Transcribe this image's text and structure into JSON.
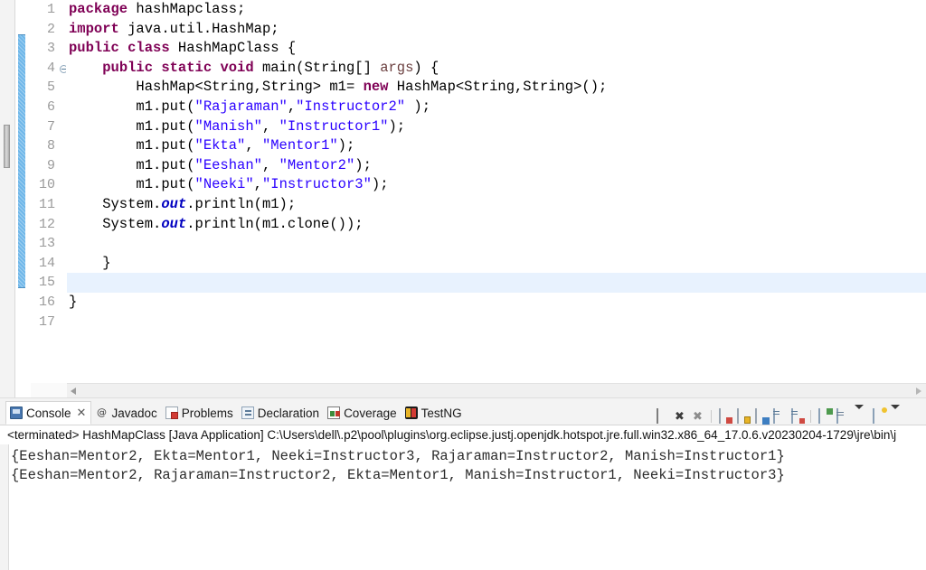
{
  "editor": {
    "name": "java-source-editor",
    "current_line": 15,
    "total_lines": 17,
    "line_numbers": [
      "1",
      "2",
      "3",
      "4",
      "5",
      "6",
      "7",
      "8",
      "9",
      "10",
      "11",
      "12",
      "13",
      "14",
      "15",
      "16",
      "17"
    ],
    "fold_marker_line": 4,
    "lines": [
      {
        "n": "1",
        "tokens": [
          {
            "t": "package",
            "c": "kw"
          },
          {
            "t": " hashMapclass;",
            "c": "plain"
          }
        ]
      },
      {
        "n": "2",
        "tokens": [
          {
            "t": "import",
            "c": "kw"
          },
          {
            "t": " java.util.HashMap;",
            "c": "plain"
          }
        ]
      },
      {
        "n": "3",
        "tokens": [
          {
            "t": "public class",
            "c": "kw"
          },
          {
            "t": " HashMapClass {",
            "c": "plain"
          }
        ]
      },
      {
        "n": "4",
        "tokens": [
          {
            "t": "    ",
            "c": "plain"
          },
          {
            "t": "public static void",
            "c": "kw"
          },
          {
            "t": " main(String[] ",
            "c": "plain"
          },
          {
            "t": "args",
            "c": "param"
          },
          {
            "t": ") {",
            "c": "plain"
          }
        ]
      },
      {
        "n": "5",
        "tokens": [
          {
            "t": "        HashMap<String,String> m1= ",
            "c": "plain"
          },
          {
            "t": "new",
            "c": "kw"
          },
          {
            "t": " HashMap<String,String>();",
            "c": "plain"
          }
        ]
      },
      {
        "n": "6",
        "tokens": [
          {
            "t": "        m1.put(",
            "c": "plain"
          },
          {
            "t": "\"Rajaraman\"",
            "c": "str"
          },
          {
            "t": ",",
            "c": "plain"
          },
          {
            "t": "\"Instructor2\"",
            "c": "str"
          },
          {
            "t": " );",
            "c": "plain"
          }
        ]
      },
      {
        "n": "7",
        "tokens": [
          {
            "t": "        m1.put(",
            "c": "plain"
          },
          {
            "t": "\"Manish\"",
            "c": "str"
          },
          {
            "t": ", ",
            "c": "plain"
          },
          {
            "t": "\"Instructor1\"",
            "c": "str"
          },
          {
            "t": ");",
            "c": "plain"
          }
        ]
      },
      {
        "n": "8",
        "tokens": [
          {
            "t": "        m1.put(",
            "c": "plain"
          },
          {
            "t": "\"Ekta\"",
            "c": "str"
          },
          {
            "t": ", ",
            "c": "plain"
          },
          {
            "t": "\"Mentor1\"",
            "c": "str"
          },
          {
            "t": ");",
            "c": "plain"
          }
        ]
      },
      {
        "n": "9",
        "tokens": [
          {
            "t": "        m1.put(",
            "c": "plain"
          },
          {
            "t": "\"Eeshan\"",
            "c": "str"
          },
          {
            "t": ", ",
            "c": "plain"
          },
          {
            "t": "\"Mentor2\"",
            "c": "str"
          },
          {
            "t": ");",
            "c": "plain"
          }
        ]
      },
      {
        "n": "10",
        "tokens": [
          {
            "t": "        m1.put(",
            "c": "plain"
          },
          {
            "t": "\"Neeki\"",
            "c": "str"
          },
          {
            "t": ",",
            "c": "plain"
          },
          {
            "t": "\"Instructor3\"",
            "c": "str"
          },
          {
            "t": ");",
            "c": "plain"
          }
        ]
      },
      {
        "n": "11",
        "tokens": [
          {
            "t": "    System.",
            "c": "plain"
          },
          {
            "t": "out",
            "c": "fieldst"
          },
          {
            "t": ".println(m1);",
            "c": "plain"
          }
        ]
      },
      {
        "n": "12",
        "tokens": [
          {
            "t": "    System.",
            "c": "plain"
          },
          {
            "t": "out",
            "c": "fieldst"
          },
          {
            "t": ".println(m1.clone());",
            "c": "plain"
          }
        ]
      },
      {
        "n": "13",
        "tokens": [
          {
            "t": "",
            "c": "plain"
          }
        ]
      },
      {
        "n": "14",
        "tokens": [
          {
            "t": "    }",
            "c": "plain"
          }
        ]
      },
      {
        "n": "15",
        "tokens": [
          {
            "t": "",
            "c": "plain"
          }
        ]
      },
      {
        "n": "16",
        "tokens": [
          {
            "t": "}",
            "c": "plain"
          }
        ]
      },
      {
        "n": "17",
        "tokens": [
          {
            "t": "",
            "c": "plain"
          }
        ]
      }
    ]
  },
  "bottom_panel": {
    "tabs": [
      {
        "label": "Console",
        "icon": "console-icon",
        "active": true,
        "closable": true,
        "close_glyph": "✕"
      },
      {
        "label": "Javadoc",
        "icon": "javadoc-icon",
        "active": false,
        "closable": false,
        "glyph": "@"
      },
      {
        "label": "Problems",
        "icon": "problems-icon",
        "active": false,
        "closable": false
      },
      {
        "label": "Declaration",
        "icon": "declaration-icon",
        "active": false,
        "closable": false
      },
      {
        "label": "Coverage",
        "icon": "coverage-icon",
        "active": false,
        "closable": false
      },
      {
        "label": "TestNG",
        "icon": "testng-icon",
        "active": false,
        "closable": false
      }
    ],
    "toolbar_buttons": [
      {
        "name": "terminate-button",
        "glyph": ""
      },
      {
        "name": "remove-launch-button",
        "glyph": "✖"
      },
      {
        "name": "remove-all-launches-button",
        "glyph": "✖"
      },
      {
        "name": "clear-console-button",
        "glyph": ""
      },
      {
        "name": "lock-scroll-button",
        "glyph": ""
      },
      {
        "name": "show-console-on-output-button",
        "glyph": ""
      },
      {
        "name": "pin-console-button",
        "glyph": ""
      },
      {
        "name": "display-selected-console-button",
        "glyph": ""
      },
      {
        "name": "open-console-button",
        "glyph": ""
      },
      {
        "name": "new-console-view-button",
        "glyph": ""
      },
      {
        "name": "open-console-dropdown",
        "glyph": "▼"
      },
      {
        "name": "view-menu-button",
        "glyph": ""
      },
      {
        "name": "view-menu-dropdown",
        "glyph": "▼"
      },
      {
        "name": "minimize-view-button",
        "glyph": ""
      }
    ],
    "launch_status": "<terminated> HashMapClass [Java Application] C:\\Users\\dell\\.p2\\pool\\plugins\\org.eclipse.justj.openjdk.hotspot.jre.full.win32.x86_64_17.0.6.v20230204-1729\\jre\\bin\\j",
    "console_lines": [
      "{Eeshan=Mentor2, Ekta=Mentor1, Neeki=Instructor3, Rajaraman=Instructor2, Manish=Instructor1}",
      "{Eeshan=Mentor2, Rajaraman=Instructor2, Ekta=Mentor1, Manish=Instructor1, Neeki=Instructor3}"
    ]
  },
  "colors": {
    "keyword": "#7F0055",
    "string": "#2A00FF",
    "static_field": "#0000C0",
    "parameter": "#6A3E3E",
    "current_line_highlight": "#E8F2FE",
    "change_bar": "#6FB7E9",
    "panel_background": "#F3F3F3",
    "editor_background": "#FFFFFF"
  }
}
